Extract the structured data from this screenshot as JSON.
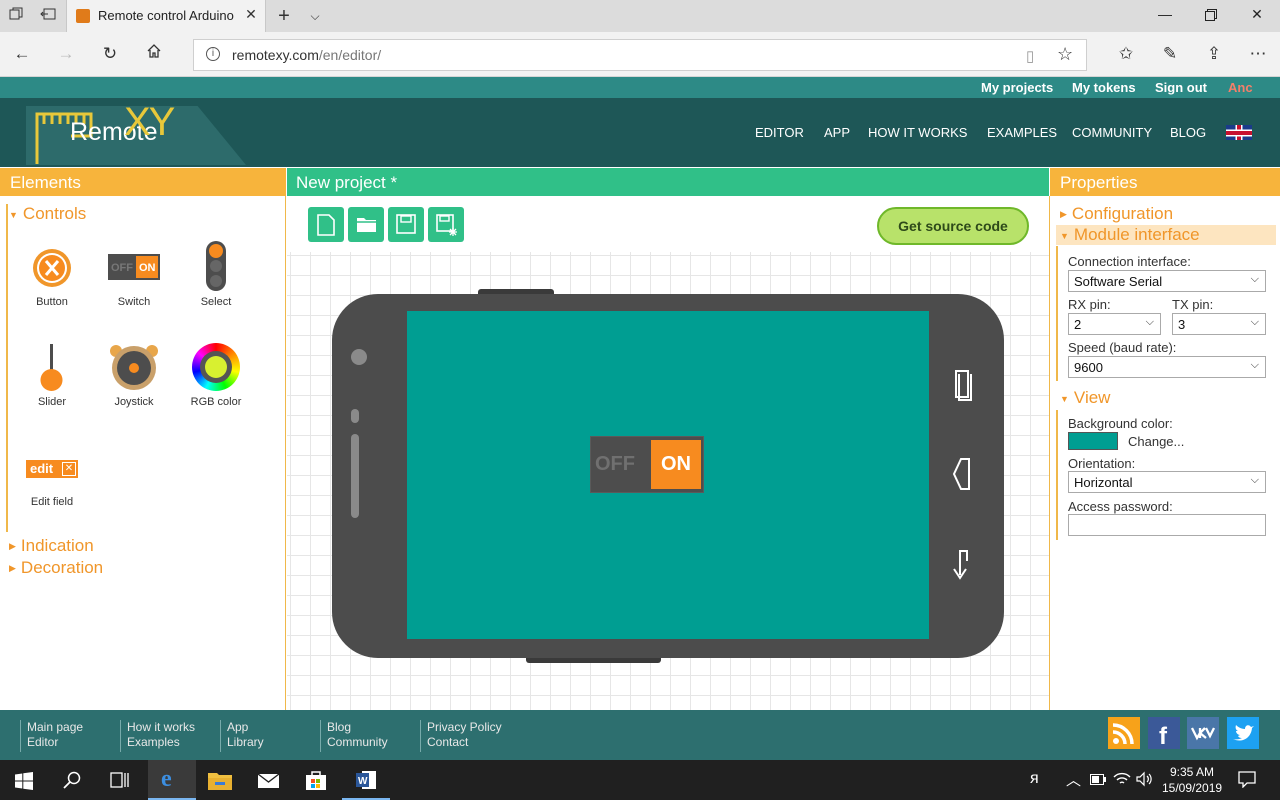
{
  "browser": {
    "tab_title": "Remote control Arduino",
    "url_host": "remotexy.com",
    "url_path": "/en/editor/"
  },
  "site": {
    "top_links": [
      "My projects",
      "My tokens",
      "Sign out",
      "Anc"
    ],
    "logo_text": "Remote",
    "logo_xy": "XY",
    "nav": [
      "EDITOR",
      "APP",
      "HOW IT WORKS",
      "EXAMPLES",
      "COMMUNITY",
      "BLOG"
    ]
  },
  "elements_panel": {
    "title": "Elements",
    "controls_section": "Controls",
    "items": [
      "Button",
      "Switch",
      "Select",
      "Slider",
      "Joystick",
      "RGB color",
      "Edit field"
    ],
    "edit_icon_text": "edit",
    "indication_section": "Indication",
    "decoration_section": "Decoration"
  },
  "project": {
    "title": "New project *",
    "get_source_label": "Get source code",
    "switch_off": "OFF",
    "switch_on": "ON",
    "screen_color": "#009e92"
  },
  "properties": {
    "title": "Properties",
    "configuration_section": "Configuration",
    "module_section": "Module interface",
    "connection_label": "Connection interface:",
    "connection_value": "Software Serial",
    "rx_label": "RX pin:",
    "rx_value": "2",
    "tx_label": "TX pin:",
    "tx_value": "3",
    "speed_label": "Speed (baud rate):",
    "speed_value": "9600",
    "view_section": "View",
    "bg_label": "Background color:",
    "bg_color": "#009e92",
    "change_label": "Change...",
    "orientation_label": "Orientation:",
    "orientation_value": "Horizontal",
    "password_label": "Access password:",
    "password_value": ""
  },
  "footer": {
    "columns": [
      [
        "Main page",
        "Editor"
      ],
      [
        "How it works",
        "Examples"
      ],
      [
        "App",
        "Library"
      ],
      [
        "Blog",
        "Community"
      ],
      [
        "Privacy Policy",
        "Contact"
      ]
    ],
    "social_icons": [
      "rss-icon",
      "facebook-icon",
      "vk-icon",
      "twitter-icon"
    ]
  },
  "taskbar": {
    "time": "9:35 AM",
    "date": "15/09/2019"
  },
  "colors": {
    "orange": "#f7b43c",
    "green_header": "#30c088",
    "teal_dark": "#1e5757",
    "switch_on": "#f78b1f"
  }
}
